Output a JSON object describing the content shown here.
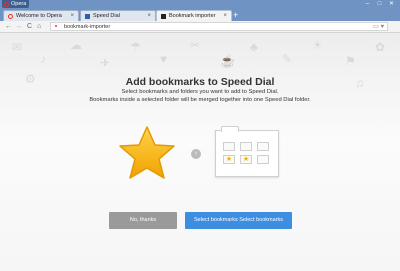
{
  "app": {
    "badge_label": "Opera"
  },
  "window_controls": [
    "–",
    "□",
    "✕"
  ],
  "tabs": [
    {
      "label": "Welcome to Opera",
      "favicon": "opera-icon",
      "close": "×"
    },
    {
      "label": "Speed Dial",
      "favicon": "speed-dial-icon",
      "close": "×"
    },
    {
      "label": "Bookmark importer",
      "favicon": "bookmark-importer-icon",
      "close": "×"
    }
  ],
  "new_tab": "+",
  "toolbar": {
    "back": "←",
    "forward": "→",
    "reload": "C",
    "home": "⌂",
    "url": "bookmark-importer",
    "speeddial_icon": "▭",
    "heart": "♥"
  },
  "page": {
    "title": "Add bookmarks to Speed Dial",
    "subtitle_line1": "Select bookmarks and folders you want to add to Speed Dial.",
    "subtitle_line2": "Bookmarks inside a selected folder will be merged together into one Speed Dial folder.",
    "arrow": "›",
    "speed_dial_preview_label": "",
    "cell_star": "★"
  },
  "buttons": {
    "no": "No, thanks",
    "yes": "Select bookmarks Select bookmarks"
  },
  "colors": {
    "window": "#6f93c3",
    "accent_blue": "#3d8de0",
    "gray_button": "#9a9a9a",
    "star": "#f4b000",
    "opera_red": "#e8322e"
  }
}
